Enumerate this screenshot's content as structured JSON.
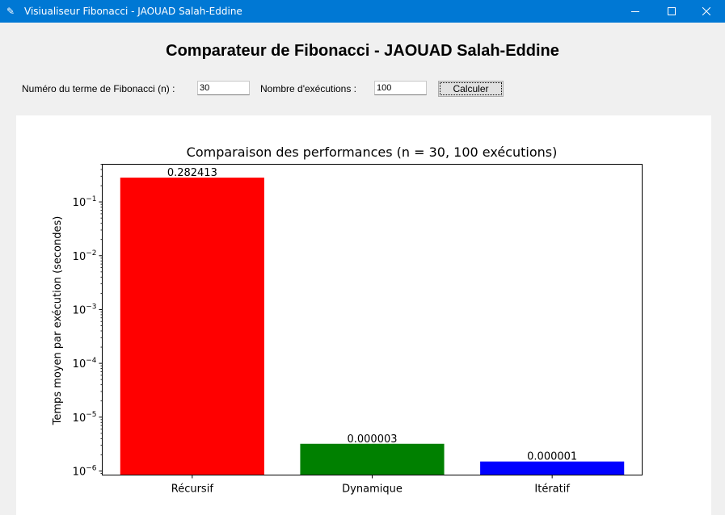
{
  "window": {
    "title": "Visiualiseur Fibonacci - JAOUAD Salah-Eddine",
    "icon": "feather-icon",
    "accent": "#0078d4"
  },
  "app": {
    "heading": "Comparateur de Fibonacci - JAOUAD Salah-Eddine",
    "n_label": "Numéro du terme de Fibonacci (n) :",
    "n_value": "30",
    "runs_label": "Nombre d'exécutions :",
    "runs_value": "100",
    "calc_label": "Calculer"
  },
  "chart_data": {
    "type": "bar",
    "title": "Comparaison des performances (n = 30, 100 exécutions)",
    "xlabel": "",
    "ylabel": "Temps moyen par exécution (secondes)",
    "yscale": "log",
    "ylim": [
      8.4e-07,
      0.5
    ],
    "categories": [
      "Récursif",
      "Dynamique",
      "Itératif"
    ],
    "values": [
      0.282413,
      3.2e-06,
      1.5e-06
    ],
    "value_labels": [
      "0.282413",
      "0.000003",
      "0.000001"
    ],
    "colors": [
      "#ff0000",
      "#008000",
      "#0000ff"
    ],
    "ytick_labels": [
      {
        "value": 1e-06,
        "base": "10",
        "exp": "−6"
      },
      {
        "value": 1e-05,
        "base": "10",
        "exp": "−5"
      },
      {
        "value": 0.0001,
        "base": "10",
        "exp": "−4"
      },
      {
        "value": 0.001,
        "base": "10",
        "exp": "−3"
      },
      {
        "value": 0.01,
        "base": "10",
        "exp": "−2"
      },
      {
        "value": 0.1,
        "base": "10",
        "exp": "−1"
      }
    ],
    "grid": false,
    "legend": "none"
  }
}
